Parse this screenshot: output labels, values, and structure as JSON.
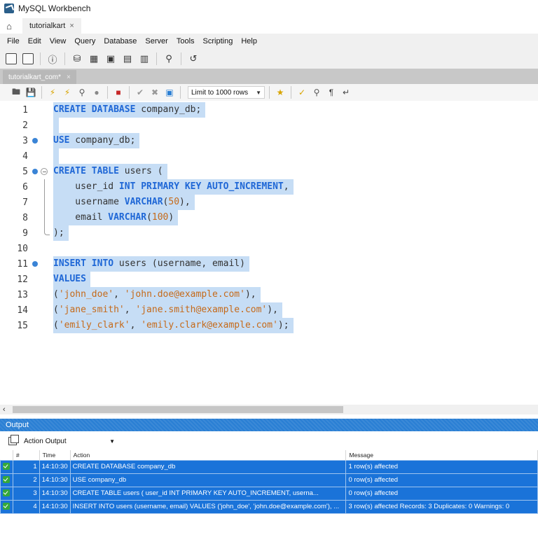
{
  "window": {
    "title": "MySQL Workbench"
  },
  "connection_tab": {
    "label": "tutorialkart",
    "close": "×"
  },
  "menu": [
    "File",
    "Edit",
    "View",
    "Query",
    "Database",
    "Server",
    "Tools",
    "Scripting",
    "Help"
  ],
  "editor_tab": {
    "label": "tutorialkart_com*",
    "close": "×"
  },
  "sql_toolbar": {
    "limit_label": "Limit to 1000 rows"
  },
  "code": {
    "lines": [
      {
        "n": "1",
        "dot": false
      },
      {
        "n": "2",
        "dot": false
      },
      {
        "n": "3",
        "dot": true
      },
      {
        "n": "4",
        "dot": false
      },
      {
        "n": "5",
        "dot": true
      },
      {
        "n": "6",
        "dot": false
      },
      {
        "n": "7",
        "dot": false
      },
      {
        "n": "8",
        "dot": false
      },
      {
        "n": "9",
        "dot": false
      },
      {
        "n": "10",
        "dot": false
      },
      {
        "n": "11",
        "dot": true
      },
      {
        "n": "12",
        "dot": false
      },
      {
        "n": "13",
        "dot": false
      },
      {
        "n": "14",
        "dot": false
      },
      {
        "n": "15",
        "dot": false
      }
    ],
    "l1_kw": "CREATE DATABASE",
    "l1_rest": " company_db;",
    "l3_kw": "USE",
    "l3_rest": " company_db;",
    "l5_kw": "CREATE TABLE",
    "l5_rest": " users (",
    "l6_pre": "    user_id ",
    "l6_kw": "INT PRIMARY KEY AUTO_INCREMENT",
    "l6_rest": ",",
    "l7_pre": "    username ",
    "l7_kw": "VARCHAR",
    "l7_open": "(",
    "l7_num": "50",
    "l7_close": "),",
    "l8_pre": "    email ",
    "l8_kw": "VARCHAR",
    "l8_open": "(",
    "l8_num": "100",
    "l8_close": ")",
    "l9": ");",
    "l11_kw": "INSERT INTO",
    "l11_rest": " users (username, email)",
    "l12_kw": "VALUES",
    "l13_a": "(",
    "l13_s1": "'john_doe'",
    "l13_b": ", ",
    "l13_s2": "'john.doe@example.com'",
    "l13_c": "),",
    "l14_a": "(",
    "l14_s1": "'jane_smith'",
    "l14_b": ", ",
    "l14_s2": "'jane.smith@example.com'",
    "l14_c": "),",
    "l15_a": "(",
    "l15_s1": "'emily_clark'",
    "l15_b": ", ",
    "l15_s2": "'emily.clark@example.com'",
    "l15_c": ");"
  },
  "output": {
    "panel_title": "Output",
    "selector": "Action Output",
    "columns": {
      "num": "#",
      "time": "Time",
      "action": "Action",
      "message": "Message"
    },
    "rows": [
      {
        "num": "1",
        "time": "14:10:30",
        "action": "CREATE DATABASE company_db",
        "message": "1 row(s) affected"
      },
      {
        "num": "2",
        "time": "14:10:30",
        "action": "USE company_db",
        "message": "0 row(s) affected"
      },
      {
        "num": "3",
        "time": "14:10:30",
        "action": "CREATE TABLE users (    user_id INT PRIMARY KEY AUTO_INCREMENT,     userna...",
        "message": "0 row(s) affected"
      },
      {
        "num": "4",
        "time": "14:10:30",
        "action": "INSERT INTO users (username, email) VALUES  ('john_doe', 'john.doe@example.com'), ...",
        "message": "3 row(s) affected Records: 3  Duplicates: 0  Warnings: 0"
      }
    ]
  },
  "colors": {
    "accent": "#2a7fd4",
    "selection": "#c6ddf5",
    "keyword": "#1f67d6",
    "string": "#c56a1a",
    "success": "#35a83a"
  }
}
